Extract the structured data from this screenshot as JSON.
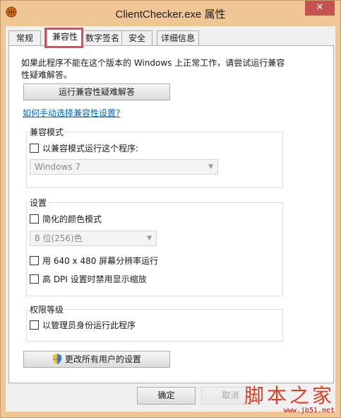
{
  "window": {
    "title": "ClientChecker.exe 属性",
    "close_label": "✕"
  },
  "tabs": [
    {
      "label": "常规",
      "active": false
    },
    {
      "label": "兼容性",
      "active": true
    },
    {
      "label": "数字签名",
      "active": false
    },
    {
      "label": "安全",
      "active": false
    },
    {
      "label": "详细信息",
      "active": false
    }
  ],
  "compat": {
    "description": "如果此程序不能在这个版本的 Windows 上正常工作，请尝试运行兼容性疑难解答。",
    "troubleshoot_button": "运行兼容性疑难解答",
    "manual_link": "如何手动选择兼容性设置?",
    "mode_group": {
      "label": "兼容模式",
      "checkbox": "以兼容模式运行这个程序:",
      "os_select": "Windows 7"
    },
    "settings_group": {
      "label": "设置",
      "reduced_color": "简化的颜色模式",
      "color_select": "8 位(256)色",
      "resolution": "用 640 x 480 屏幕分辨率运行",
      "dpi": "高 DPI 设置时禁用显示缩放"
    },
    "privilege_group": {
      "label": "权限等级",
      "admin": "以管理员身份运行此程序"
    },
    "all_users_button": "更改所有用户的设置"
  },
  "footer": {
    "ok": "确定",
    "cancel": "取消"
  },
  "watermark": {
    "main": "脚本之家",
    "sub": "www.jb51.net"
  }
}
